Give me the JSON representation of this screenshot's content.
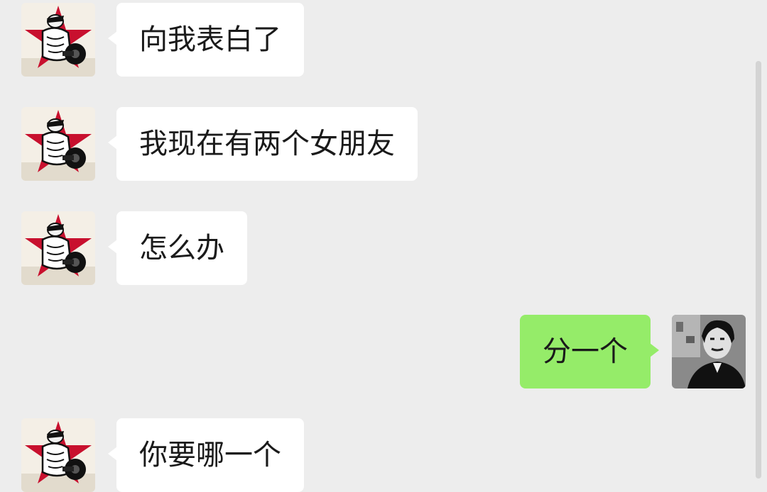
{
  "messages": [
    {
      "side": "incoming",
      "text": "向我表白了"
    },
    {
      "side": "incoming",
      "text": "我现在有两个女朋友"
    },
    {
      "side": "incoming",
      "text": "怎么办"
    },
    {
      "side": "outgoing",
      "text": "分一个"
    },
    {
      "side": "incoming",
      "text": "你要哪一个"
    }
  ],
  "icons": {
    "contact_avatar": "bodybuilder-red-star-avatar",
    "self_avatar": "man-portrait-avatar"
  },
  "colors": {
    "background": "#ededed",
    "incoming_bubble": "#ffffff",
    "outgoing_bubble": "#95ec69",
    "text": "#1a1a1a",
    "star": "#c8102e"
  }
}
